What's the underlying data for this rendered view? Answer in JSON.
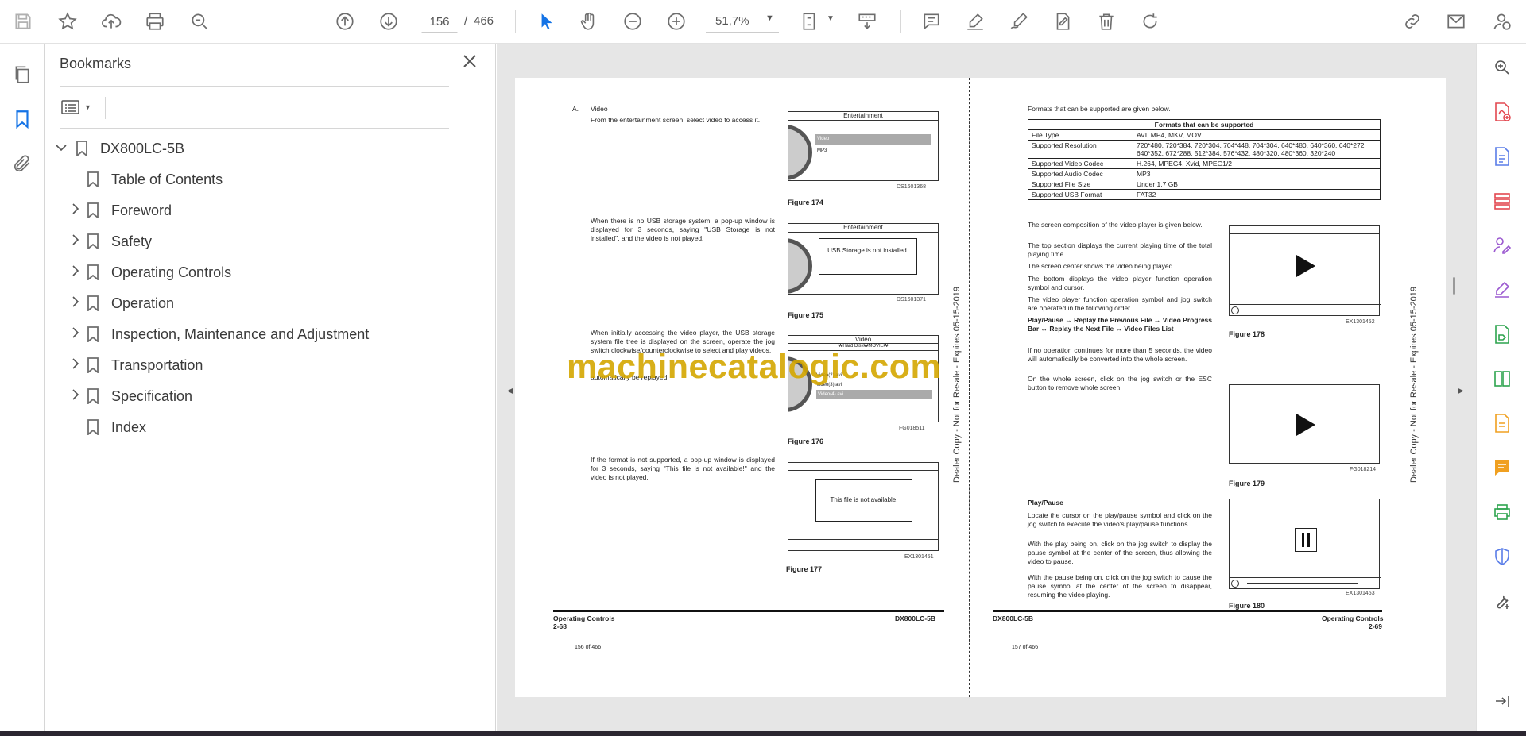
{
  "toolbar": {
    "current_page": "156",
    "page_separator": "/",
    "total_pages": "466",
    "zoom": "51,7%"
  },
  "bookmarks": {
    "title": "Bookmarks",
    "root": "DX800LC-5B",
    "items": [
      {
        "label": "Table of Contents",
        "expandable": false
      },
      {
        "label": "Foreword",
        "expandable": true
      },
      {
        "label": "Safety",
        "expandable": true
      },
      {
        "label": "Operating Controls",
        "expandable": true
      },
      {
        "label": "Operation",
        "expandable": true
      },
      {
        "label": "Inspection, Maintenance and Adjustment",
        "expandable": true
      },
      {
        "label": "Transportation",
        "expandable": true
      },
      {
        "label": "Specification",
        "expandable": true
      },
      {
        "label": "Index",
        "expandable": false
      }
    ]
  },
  "watermark": "machinecatalogic.com",
  "left_page": {
    "section_letter": "A.",
    "section_title": "Video",
    "p1": "From the entertainment screen, select video to access it.",
    "p2": "When there is no USB storage system, a pop-up window is displayed for 3 seconds, saying \"USB Storage is not installed\", and the video is not played.",
    "p3": "When initially accessing the video player, the USB storage system file tree is displayed on the screen, operate the jog switch clockwise/counterclockwise to select and play videos.",
    "p3b": "automatically be replayed.",
    "p4": "If the format is not supported, a pop-up window is displayed for 3 seconds, saying \"This file is not available!\" and the video is not played.",
    "fig174": {
      "caption": "Figure 174",
      "code": "DS1601368",
      "screen_title": "Entertainment",
      "item1": "Video",
      "item2": "MP3"
    },
    "fig175": {
      "caption": "Figure 175",
      "code": "DS1601371",
      "screen_title": "Entertainment",
      "popup": "USB Storage is not installed."
    },
    "fig176": {
      "caption": "Figure 176",
      "code": "FG018511",
      "screen_title": "Video",
      "path": "₩Hard Disk₩MOVIE₩",
      "files": [
        "Video(2).avi",
        "Video(3).avi",
        "Video(4).avi"
      ]
    },
    "fig177": {
      "caption": "Figure 177",
      "code": "EX1301451",
      "popup": "This file is not available!"
    },
    "footer_section": "Operating Controls",
    "footer_page": "2-68",
    "footer_model": "DX800LC-5B",
    "page_of": "156 of 466",
    "side_text": "Dealer Copy - Not for Resale - Expires 05-15-2019"
  },
  "right_page": {
    "intro": "Formats that can be supported are given below.",
    "table": {
      "header": "Formats that can be supported",
      "rows": [
        [
          "File Type",
          "AVI, MP4, MKV, MOV"
        ],
        [
          "Supported Resolution",
          "720*480, 720*384, 720*304, 704*448, 704*304, 640*480, 640*360, 640*272, 640*352, 672*288, 512*384, 576*432, 480*320, 480*360, 320*240"
        ],
        [
          "Supported Video Codec",
          "H.264, MPEG4, Xvid, MPEG1/2"
        ],
        [
          "Supported Audio Codec",
          "MP3"
        ],
        [
          "Supported File Size",
          "Under 1.7 GB"
        ],
        [
          "Supported USB Format",
          "FAT32"
        ]
      ]
    },
    "p1": "The screen composition of the video player is given below.",
    "p2": "The top section displays the current playing time of the total playing time.",
    "p3": "The screen center shows the video being played.",
    "p4": "The bottom displays the video player function operation symbol and cursor.",
    "p5": "The video player function operation symbol and jog switch are operated in the following order.",
    "p6": "Play/Pause ↔ Replay the Previous File ↔ Video Progress Bar ↔ Replay the Next File ↔ Video Files List",
    "p7": "If no operation continues for more than 5 seconds, the video will automatically be converted into the whole screen.",
    "p8": "On the whole screen, click on the jog switch or the ESC button to remove whole screen.",
    "heading_pp": "Play/Pause",
    "p9": "Locate the cursor on the play/pause symbol and click on the jog switch to execute the video's play/pause functions.",
    "p10": "With the play being on, click on the jog switch to display the pause symbol at the center of the screen, thus allowing the video to pause.",
    "p11": "With the pause being on, click on the jog switch to cause the pause symbol at the center of the screen to disappear, resuming the video playing.",
    "fig178": {
      "caption": "Figure 178",
      "code": "EX1301452"
    },
    "fig179": {
      "caption": "Figure 179",
      "code": "FG018214"
    },
    "fig180": {
      "caption": "Figure 180",
      "code": "EX1301453"
    },
    "footer_section": "Operating Controls",
    "footer_page": "2-69",
    "footer_model": "DX800LC-5B",
    "page_of": "157 of 466",
    "side_text": "Dealer Copy - Not for Resale - Expires 05-15-2019"
  },
  "colors": {
    "accent_blue": "#1473e6",
    "icon_gray": "#6e6e6e",
    "rail_red": "#e34850",
    "rail_blue": "#5a7de8",
    "rail_purple": "#9b59d0",
    "rail_green": "#2da44e",
    "rail_orange": "#f0a020",
    "watermark": "#d4a600"
  }
}
